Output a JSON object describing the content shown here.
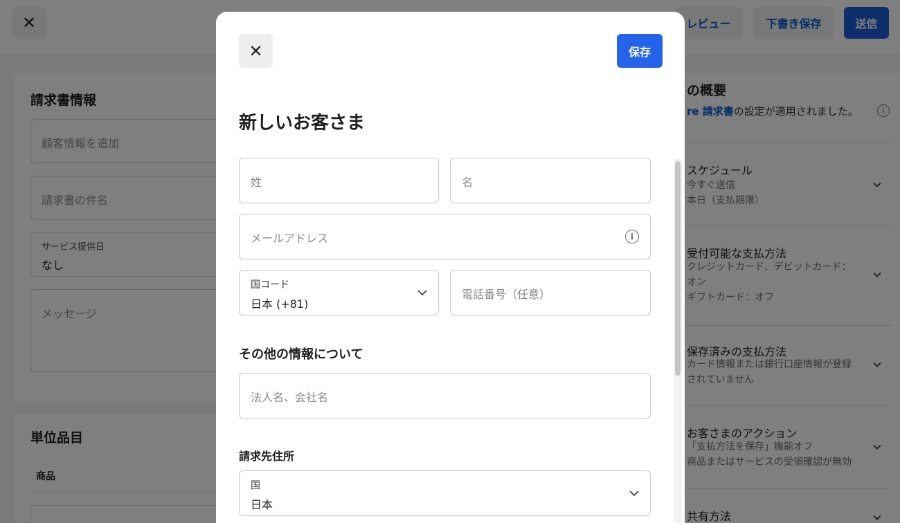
{
  "background": {
    "topbar": {
      "close_icon": "close-icon",
      "preview_label": "レビュー",
      "draft_label": "下書き保存",
      "send_label": "送信"
    },
    "left": {
      "title": "請求書情報",
      "customer_placeholder": "顧客情報を追加",
      "subject_placeholder": "請求書の件名",
      "service_date_label": "サービス提供日",
      "service_date_value": "なし",
      "message_placeholder": "メッセージ",
      "line_items_title": "単位品目",
      "product_header": "商品"
    },
    "right": {
      "title": "の概要",
      "notice_link": "re 請求書",
      "notice_text": "の設定が適用されました。",
      "sections": [
        {
          "title": "スケジュール",
          "lines": [
            "今すぐ送信",
            "本日（支払期限）"
          ]
        },
        {
          "title": "受付可能な支払方法",
          "lines": [
            "クレジットカード、デビットカード：",
            "オン",
            "ギフトカード：オフ"
          ]
        },
        {
          "title": "保存済みの支払方法",
          "lines": [
            "カード情報または銀行口座情報が登録",
            "されていません"
          ]
        },
        {
          "title": "お客さまのアクション",
          "lines": [
            "「支払方法を保存」機能オフ",
            "商品またはサービスの受領確認が無効"
          ]
        },
        {
          "title": "共有方法",
          "lines": []
        }
      ]
    }
  },
  "modal": {
    "close_icon": "close-icon",
    "save_label": "保存",
    "title": "新しいお客さま",
    "last_name_placeholder": "姓",
    "first_name_placeholder": "名",
    "email_placeholder": "メールアドレス",
    "email_info_icon": "info-icon",
    "country_code_label": "国コード",
    "country_code_value": "日本 (+81)",
    "phone_placeholder": "電話番号（任意）",
    "other_info_heading": "その他の情報について",
    "company_placeholder": "法人名、会社名",
    "billing_address_heading": "請求先住所",
    "country_label": "国",
    "country_value": "日本"
  }
}
